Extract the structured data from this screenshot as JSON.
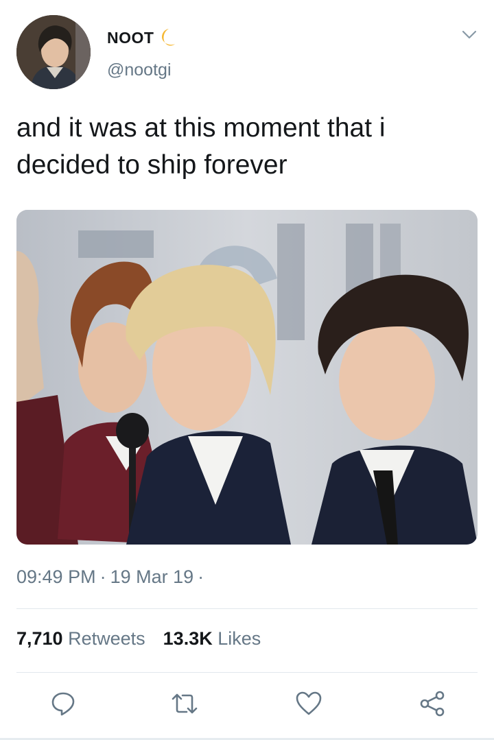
{
  "tweet": {
    "author": {
      "display_name": "NOOT",
      "name_emoji": "crescent-moon-icon",
      "handle": "@nootgi"
    },
    "text": "and it was at this moment that i decided to ship forever",
    "time": "09:49 PM",
    "date": "19 Mar 19",
    "separator": "·",
    "retweets_count": "7,710",
    "retweets_label": "Retweets",
    "likes_count": "13.3K",
    "likes_label": "Likes",
    "actions": [
      "reply-icon",
      "retweet-icon",
      "like-icon",
      "share-icon"
    ],
    "menu_icon": "chevron-down-icon"
  },
  "colors": {
    "text": "#14171a",
    "secondary": "#657786",
    "divider": "#e1e8ed",
    "moon": "#f5b731"
  }
}
